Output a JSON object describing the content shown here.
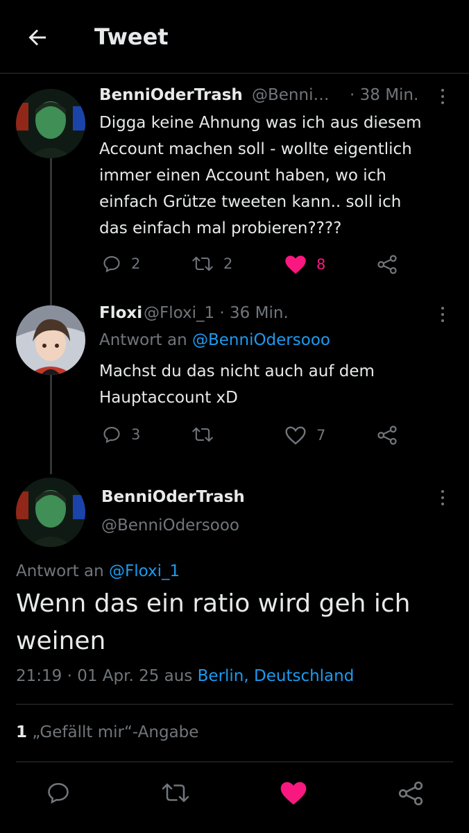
{
  "header": {
    "title": "Tweet"
  },
  "tweet1": {
    "name": "BenniOderTrash",
    "handle": "@Benni…",
    "time": "· 38 Min.",
    "text_lines": [
      "Digga keine Ahnung was ich aus diesem",
      "Account machen soll - wollte eigentlich",
      "immer einen Account haben, wo ich",
      "einfach Grütze tweeten kann.. soll ich",
      "das einfach mal probieren????"
    ],
    "replies": "2",
    "retweets": "2",
    "likes": "8",
    "liked": true
  },
  "tweet2": {
    "name": "Floxi",
    "handle_time": "@Floxi_1 · 36 Min.",
    "reply_prefix": "Antwort an",
    "reply_to": "@BenniOdersooo",
    "text_lines": [
      "Machst du das nicht auch auf dem",
      "Hauptaccount xD"
    ],
    "replies": "3",
    "retweets": "",
    "likes": "7",
    "liked": false
  },
  "main": {
    "name": "BenniOderTrash",
    "handle": "@BenniOdersooo",
    "reply_prefix": "Antwort an",
    "reply_to": "@Floxi_1",
    "text_lines": [
      "Wenn das ein ratio wird geh ich",
      "weinen"
    ],
    "time_date": "21:19 · 01 Apr. 25 aus",
    "location": "Berlin, Deutschland",
    "likes_count": "1",
    "likes_label": "„Gefällt mir“-Angabe",
    "liked": true
  },
  "colors": {
    "background": "#000000",
    "text": "#e7e9ea",
    "secondary": "#71767b",
    "link": "#1d9bf0",
    "like": "#f91880",
    "divider": "#2f3336"
  }
}
